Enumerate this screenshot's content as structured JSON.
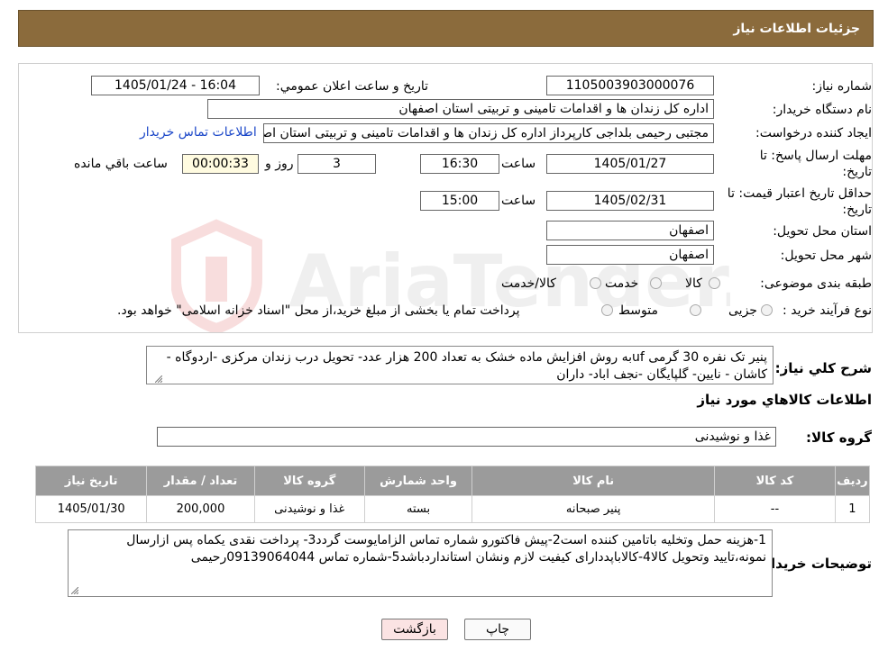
{
  "header": {
    "title": "جزئیات اطلاعات نیاز"
  },
  "form": {
    "need_number_label": "شماره نیاز:",
    "need_number": "1105003903000076",
    "announce_label": "تاریخ و ساعت اعلان عمومي:",
    "announce_value": "1405/01/24 - 16:04",
    "buyer_org_label": "نام دستگاه خريدار:",
    "buyer_org": "اداره کل زندان ها و اقدامات تامینی و تربیتی استان اصفهان",
    "requester_label": "ایجاد کننده درخواست:",
    "requester": "مجتبی رحیمی بلداجی کارپرداز اداره کل زندان ها و اقدامات تامینی و تربیتی استان اصفهان",
    "contact_link": "اطلاعات تماس خريدار",
    "deadline_label_1": "مهلت ارسال پاسخ: تا",
    "deadline_label_2": "تاریخ:",
    "deadline_date": "1405/01/27",
    "time_label": "ساعت",
    "deadline_time": "16:30",
    "days_value": "3",
    "days_label": "روز و",
    "remaining_time": "00:00:33",
    "remaining_label": "ساعت باقي مانده",
    "validity_label_1": "حداقل تاریخ اعتبار قیمت: تا",
    "validity_label_2": "تاریخ:",
    "validity_date": "1405/02/31",
    "validity_time": "15:00",
    "province_label": "استان محل تحویل:",
    "province": "اصفهان",
    "city_label": "شهر محل تحویل:",
    "city": "اصفهان",
    "category_label": "طبقه بندی موضوعی:",
    "category_options": [
      "کالا",
      "خدمت",
      "کالا/خدمت"
    ],
    "process_label": "نوع فرآیند خرید :",
    "process_options": [
      "جزیی",
      "متوسط"
    ],
    "process_note": "پرداخت تمام یا بخشی از مبلغ خرید،از محل \"اسناد خزانه اسلامی\" خواهد بود."
  },
  "summary": {
    "label": "شرح كلي نياز:",
    "text": "پنیر تک نفره 30 گرمی ufبه روش افزایش ماده خشک به تعداد 200 هزار عدد- تحویل درب زندان مرکزی -اردوگاه - کاشان - نایین- گلپایگان -نجف اباد- داران"
  },
  "goods_section": {
    "title": "اطلاعات كالاهاي مورد نياز",
    "group_label": "گروه کالا:",
    "group_value": "غذا و نوشیدنی"
  },
  "table": {
    "headers": [
      "ردیف",
      "کد کالا",
      "نام کالا",
      "واحد شمارش",
      "گروه کالا",
      "تعداد / مقدار",
      "تاریخ نیاز"
    ],
    "rows": [
      [
        "1",
        "--",
        "پنیر صبحانه",
        "بسته",
        "غذا و نوشیدنی",
        "200,000",
        "1405/01/30"
      ]
    ]
  },
  "notes": {
    "label": "توضیحات خریدار:",
    "text": "1-هزینه حمل وتخلیه باتامین کننده است2-پیش فاکتورو شماره تماس الزامایوست گردد3- پرداخت نقدی یکماه  پس ازارسال نمونه،تایید وتحویل کالا4-کالاباپددارای کیفیت لازم ونشان استانداردباشد5-شماره تماس 09139064044رحیمی"
  },
  "buttons": {
    "print": "چاپ",
    "back": "بازگشت"
  },
  "colors": {
    "header_bg": "#8b6b3c",
    "link": "#1a46c8",
    "table_header": "#9b9b9b",
    "back_button": "#fbe3e3"
  }
}
